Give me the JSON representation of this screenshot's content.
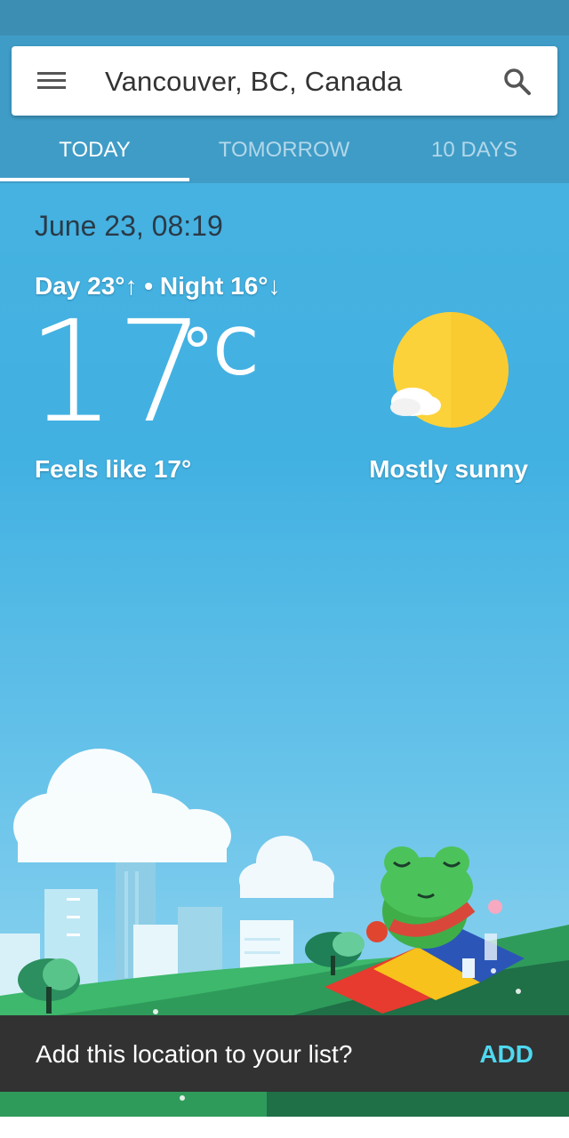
{
  "search": {
    "location": "Vancouver, BC, Canada",
    "menu_icon": "hamburger-menu-icon",
    "search_icon": "search-icon"
  },
  "tabs": [
    {
      "label": "TODAY",
      "active": true
    },
    {
      "label": "TOMORROW",
      "active": false
    },
    {
      "label": "10 DAYS",
      "active": false
    }
  ],
  "weather": {
    "datetime": "June 23, 08:19",
    "day_night": "Day 23°↑ • Night 16°↓",
    "temperature": "17",
    "unit": "°C",
    "feels_like": "Feels like 17°",
    "condition": "Mostly sunny",
    "condition_icon": "sun-with-cloud-icon"
  },
  "snackbar": {
    "message": "Add this location to your list?",
    "action": "ADD"
  },
  "colors": {
    "header": "#3f9cc7",
    "sky": "#41b1e2",
    "sun": "#fcd23a",
    "snackbar": "#323232",
    "accent": "#4fd8f0"
  }
}
